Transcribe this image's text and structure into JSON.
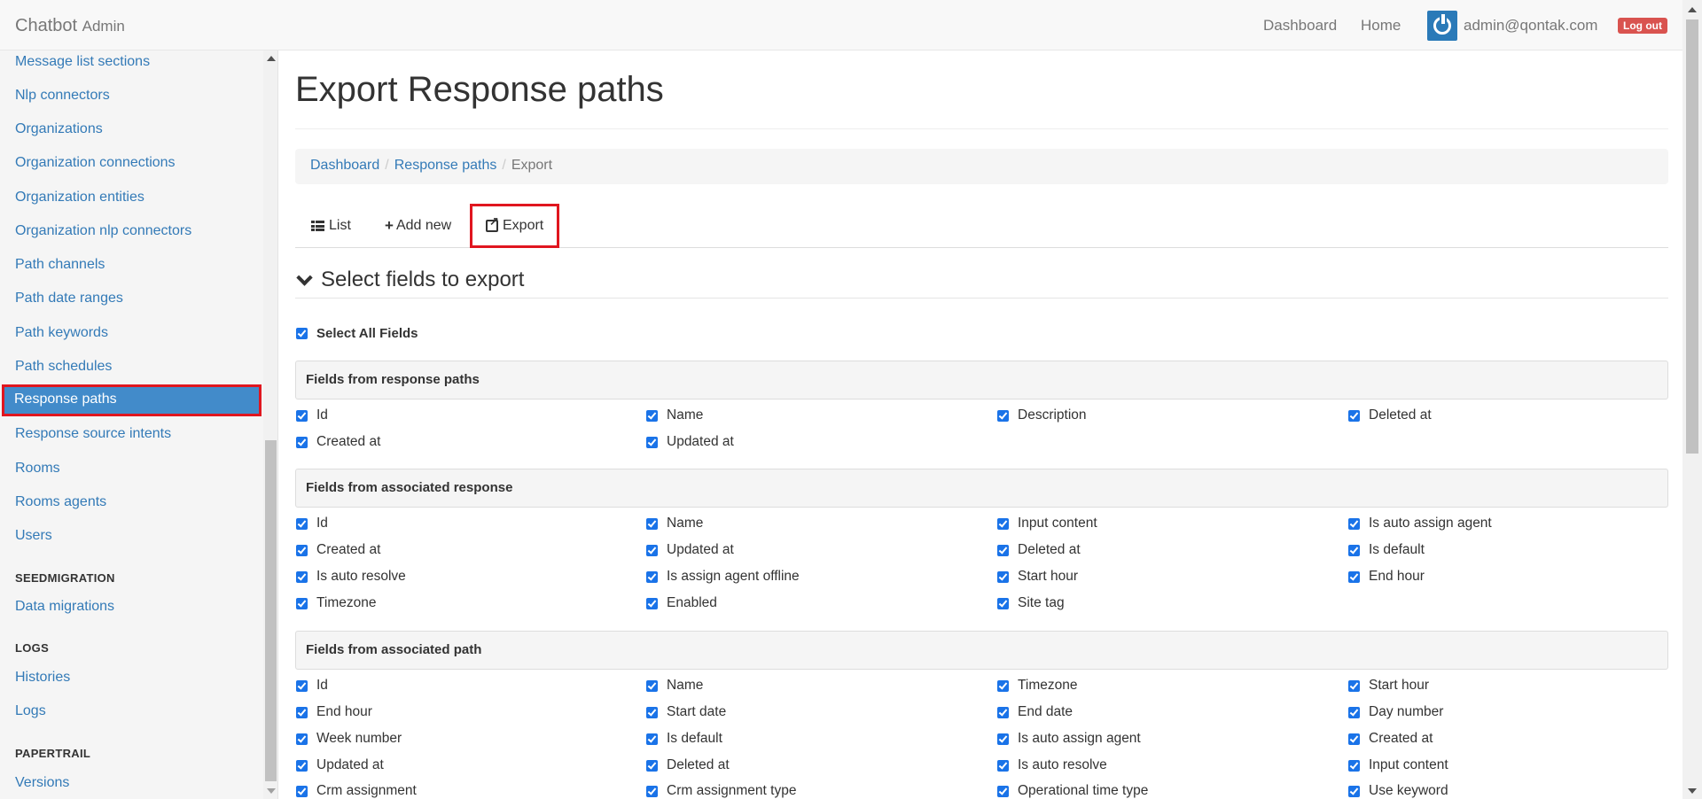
{
  "navbar": {
    "brand": "Chatbot",
    "brand_sub": "Admin",
    "links": [
      "Dashboard",
      "Home"
    ],
    "user_email": "admin@qontak.com",
    "logout": "Log out"
  },
  "sidebar": {
    "items": [
      "Message list sections",
      "Nlp connectors",
      "Organizations",
      "Organization connections",
      "Organization entities",
      "Organization nlp connectors",
      "Path channels",
      "Path date ranges",
      "Path keywords",
      "Path schedules",
      "Response paths",
      "Response source intents",
      "Rooms",
      "Rooms agents",
      "Users"
    ],
    "groups": [
      {
        "header": "SEEDMIGRATION",
        "items": [
          "Data migrations"
        ]
      },
      {
        "header": "LOGS",
        "items": [
          "Histories",
          "Logs"
        ]
      },
      {
        "header": "PAPERTRAIL",
        "items": [
          "Versions"
        ]
      }
    ],
    "active": "Response paths"
  },
  "page": {
    "title": "Export Response paths",
    "breadcrumb": [
      "Dashboard",
      "Response paths",
      "Export"
    ],
    "tabs": {
      "list": "List",
      "add_new": "Add new",
      "export": "Export"
    },
    "section_title": "Select fields to export",
    "select_all": "Select All Fields"
  },
  "panels": [
    {
      "title": "Fields from response paths",
      "fields": [
        "Id",
        "Name",
        "Description",
        "Deleted at",
        "Created at",
        "Updated at"
      ]
    },
    {
      "title": "Fields from associated response",
      "fields": [
        "Id",
        "Name",
        "Input content",
        "Is auto assign agent",
        "Created at",
        "Updated at",
        "Deleted at",
        "Is default",
        "Is auto resolve",
        "Is assign agent offline",
        "Start hour",
        "End hour",
        "Timezone",
        "Enabled",
        "Site tag"
      ]
    },
    {
      "title": "Fields from associated path",
      "fields": [
        "Id",
        "Name",
        "Timezone",
        "Start hour",
        "End hour",
        "Start date",
        "End date",
        "Day number",
        "Week number",
        "Is default",
        "Is auto assign agent",
        "Created at",
        "Updated at",
        "Deleted at",
        "Is auto resolve",
        "Input content",
        "Crm assignment",
        "Crm assignment type",
        "Operational time type",
        "Use keyword"
      ]
    }
  ],
  "colors": {
    "link": "#337ab7",
    "active_bg": "#428bca",
    "highlight": "#e0161f",
    "checkbox": "#1a73e8",
    "logout": "#d9534f"
  }
}
